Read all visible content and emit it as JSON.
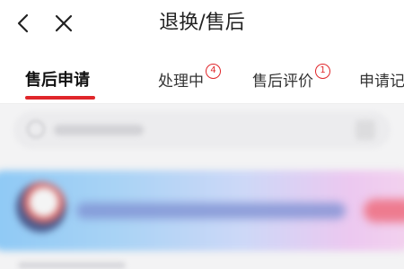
{
  "header": {
    "title": "退换/售后",
    "back_icon": "chevron-left-icon",
    "close_icon": "close-icon"
  },
  "tabs": [
    {
      "label": "售后申请",
      "active": true,
      "badge": ""
    },
    {
      "label": "处理中",
      "active": false,
      "badge": "4"
    },
    {
      "label": "售后评价",
      "active": false,
      "badge": "1"
    },
    {
      "label": "申请记",
      "active": false,
      "badge": ""
    }
  ],
  "colors": {
    "accent": "#e0262a",
    "text_primary": "#111111",
    "background": "#ffffff",
    "content_background": "#f3f3f4"
  }
}
